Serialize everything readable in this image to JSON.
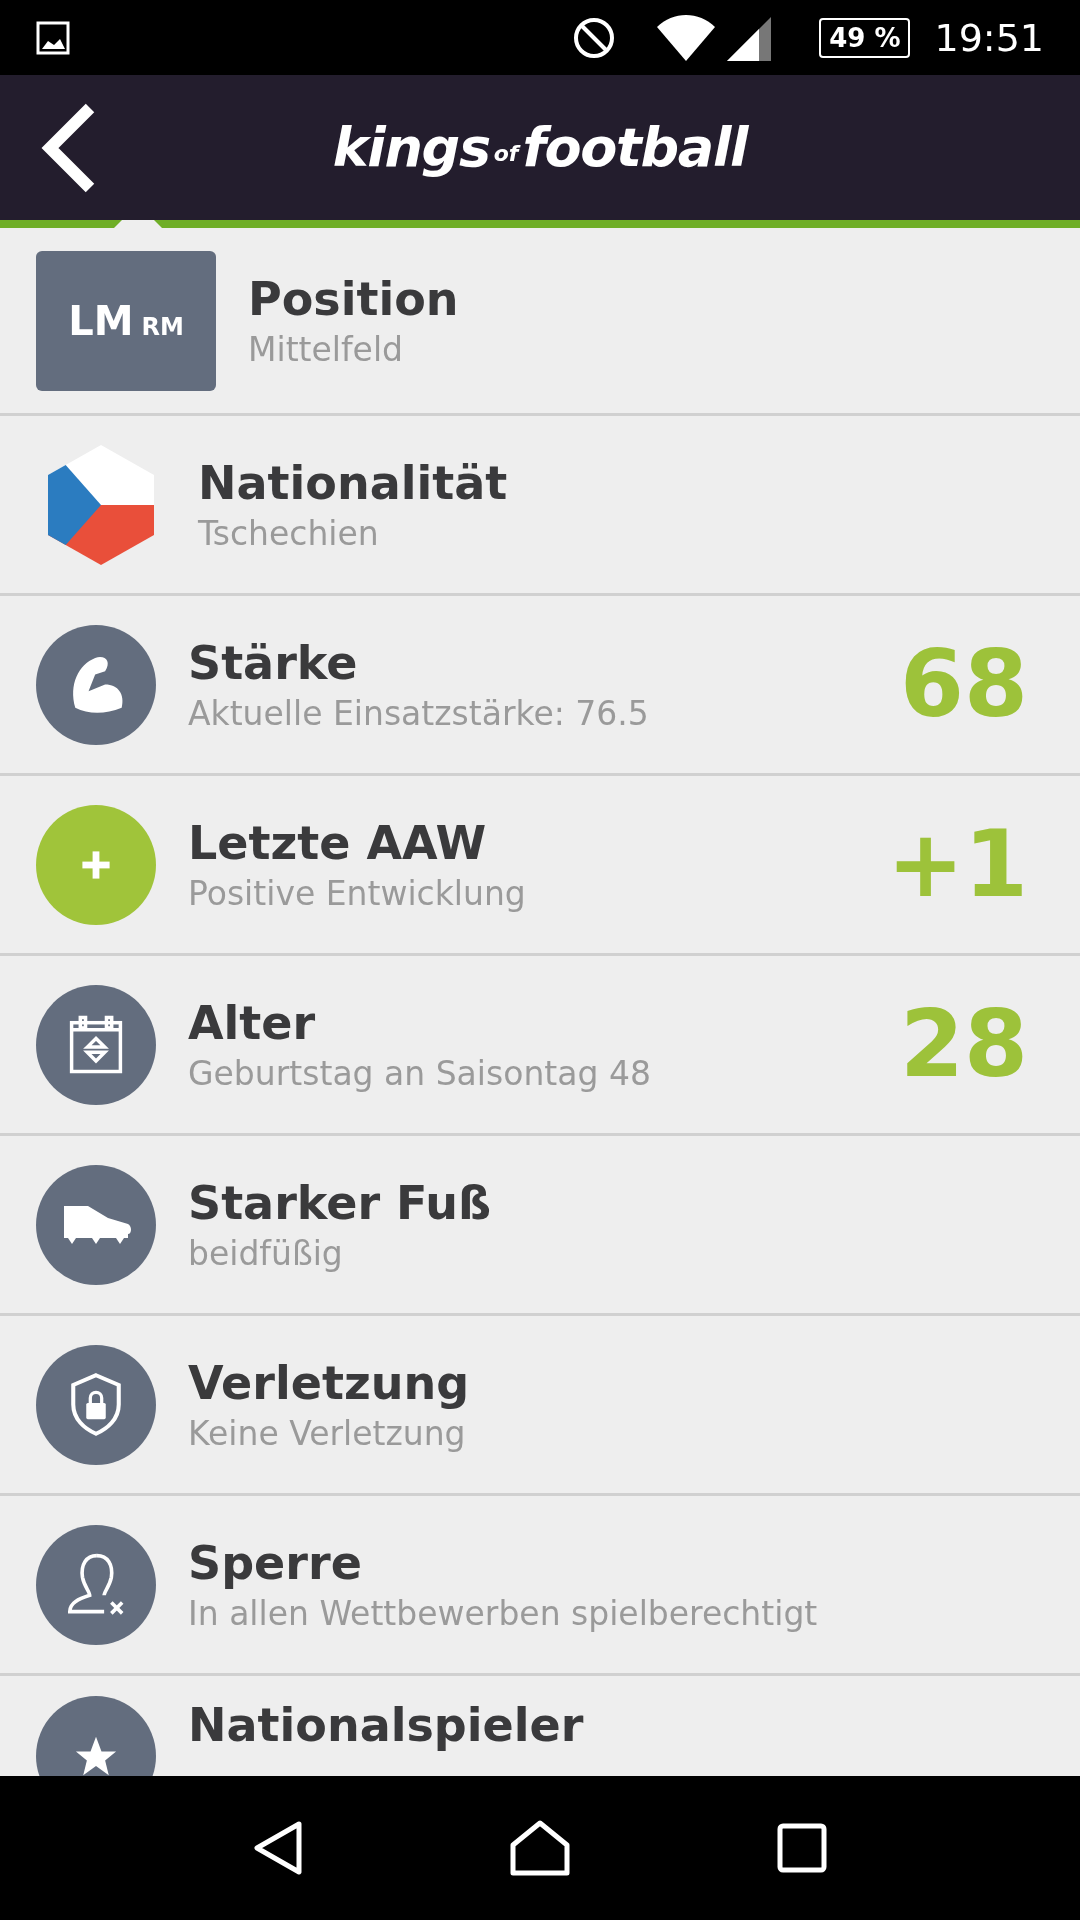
{
  "status_bar": {
    "battery": "49 %",
    "time": "19:51"
  },
  "header": {
    "logo": {
      "first": "kings",
      "middle": "of",
      "last": "football"
    }
  },
  "rows": [
    {
      "kind": "position",
      "badge_main": "LM",
      "badge_sub": "RM",
      "title": "Position",
      "subtitle": "Mittelfeld"
    },
    {
      "kind": "flag",
      "title": "Nationalität",
      "subtitle": "Tschechien"
    },
    {
      "kind": "icon",
      "color": "#636d7e",
      "title": "Stärke",
      "subtitle": "Aktuelle Einsatzstärke: 76.5",
      "value": "68"
    },
    {
      "kind": "icon",
      "color": "#a0c43a",
      "title": "Letzte AAW",
      "subtitle": "Positive Entwicklung",
      "value": "+1"
    },
    {
      "kind": "icon",
      "color": "#636d7e",
      "title": "Alter",
      "subtitle": "Geburtstag an Saisontag 48",
      "value": "28"
    },
    {
      "kind": "icon",
      "color": "#636d7e",
      "title": "Starker Fuß",
      "subtitle": "beidfüßig"
    },
    {
      "kind": "icon",
      "color": "#636d7e",
      "title": "Verletzung",
      "subtitle": "Keine Verletzung"
    },
    {
      "kind": "icon",
      "color": "#636d7e",
      "title": "Sperre",
      "subtitle": "In allen Wettbewerben spielberechtigt"
    },
    {
      "kind": "icon",
      "color": "#636d7e",
      "title": "Nationalspieler"
    }
  ]
}
